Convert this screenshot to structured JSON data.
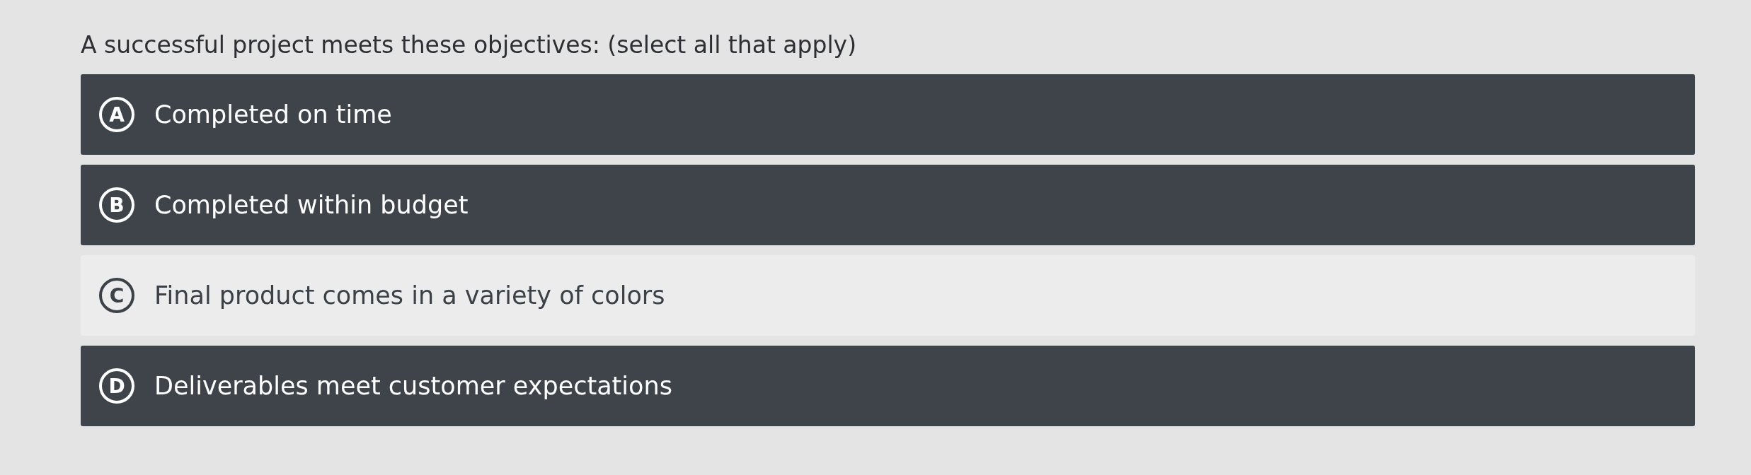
{
  "question": "A successful project meets these objectives: (select all that apply)",
  "options": [
    {
      "letter": "A",
      "text": "Completed on time",
      "selected": true
    },
    {
      "letter": "B",
      "text": "Completed within budget",
      "selected": true
    },
    {
      "letter": "C",
      "text": "Final product comes in a variety of colors",
      "selected": false
    },
    {
      "letter": "D",
      "text": "Deliverables meet customer expectations",
      "selected": true
    }
  ]
}
